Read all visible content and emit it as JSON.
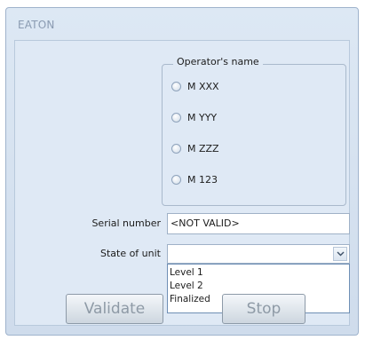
{
  "window": {
    "title": "EATON"
  },
  "operator_group": {
    "legend": "Operator's name",
    "options": [
      "M XXX",
      "M YYY",
      "M ZZZ",
      "M 123"
    ]
  },
  "serial": {
    "label": "Serial number",
    "value": "<NOT VALID>"
  },
  "state": {
    "label": "State of unit",
    "value": "",
    "options": [
      "Level 1",
      "Level 2",
      "Finalized"
    ]
  },
  "buttons": {
    "validate": "Validate",
    "stop": "Stop"
  },
  "icons": {
    "combo_arrow": "chevron-down-icon"
  }
}
